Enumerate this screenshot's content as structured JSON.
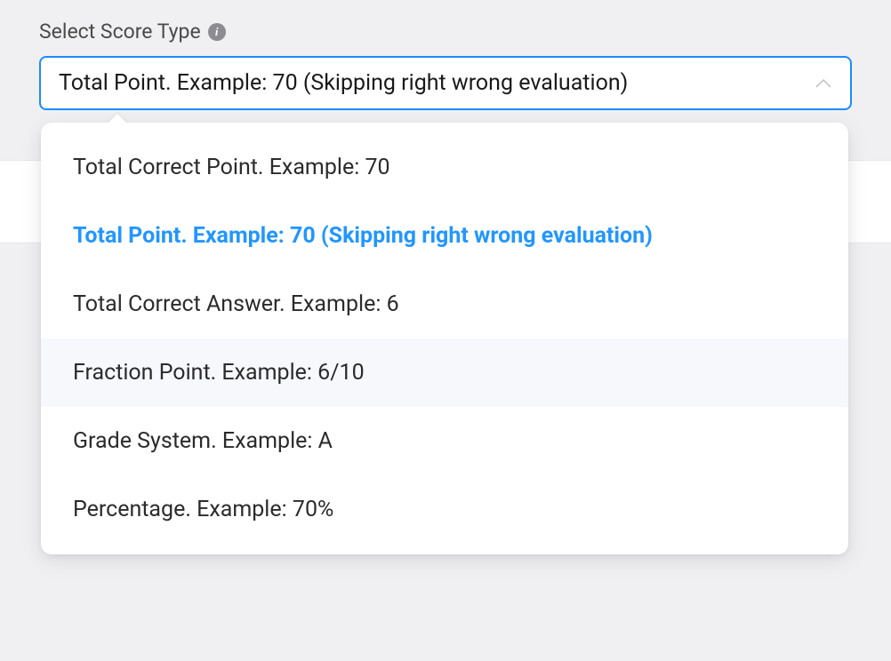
{
  "label": "Select Score Type",
  "info_tooltip": "i",
  "selected_value": "Total Point. Example: 70 (Skipping right wrong evaluation)",
  "options": [
    {
      "label": "Total Correct Point. Example: 70",
      "selected": false,
      "hovered": false
    },
    {
      "label": "Total Point. Example: 70 (Skipping right wrong evaluation)",
      "selected": true,
      "hovered": false
    },
    {
      "label": "Total Correct Answer. Example: 6",
      "selected": false,
      "hovered": false
    },
    {
      "label": "Fraction Point. Example: 6/10",
      "selected": false,
      "hovered": true
    },
    {
      "label": "Grade System. Example: A",
      "selected": false,
      "hovered": false
    },
    {
      "label": "Percentage. Example: 70%",
      "selected": false,
      "hovered": false
    }
  ]
}
